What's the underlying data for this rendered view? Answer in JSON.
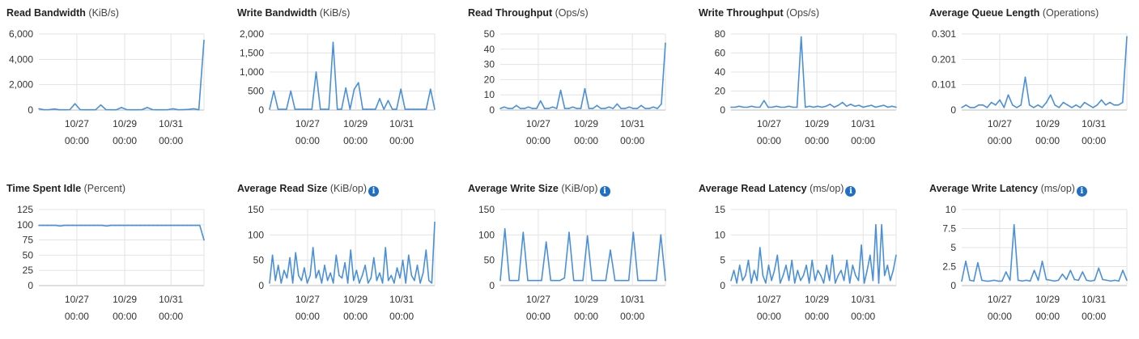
{
  "dashboard": {
    "panels": [
      {
        "title": "Read Bandwidth",
        "unit": "(KiB/s)",
        "info": false
      },
      {
        "title": "Write Bandwidth",
        "unit": "(KiB/s)",
        "info": false
      },
      {
        "title": "Read Throughput",
        "unit": "(Ops/s)",
        "info": false
      },
      {
        "title": "Write Throughput",
        "unit": "(Ops/s)",
        "info": false
      },
      {
        "title": "Average Queue Length",
        "unit": "(Operations)",
        "info": false
      },
      {
        "title": "Time Spent Idle",
        "unit": "(Percent)",
        "info": false
      },
      {
        "title": "Average Read Size",
        "unit": "(KiB/op)",
        "info": true
      },
      {
        "title": "Average Write Size",
        "unit": "(KiB/op)",
        "info": true
      },
      {
        "title": "Average Read Latency",
        "unit": "(ms/op)",
        "info": true
      },
      {
        "title": "Average Write Latency",
        "unit": "(ms/op)",
        "info": true
      }
    ]
  },
  "colors": {
    "line": "#4a90d9",
    "grid": "#e3e3e3",
    "baseline": "#bdbdbd"
  },
  "chart_data": [
    {
      "type": "line",
      "title": "Read Bandwidth",
      "ylabel": "KiB/s",
      "ylim": [
        0,
        6000
      ],
      "yticks": [
        "0",
        "2,000",
        "4,000",
        "6,000"
      ],
      "xticks": [
        "10/27",
        "10/29",
        "10/31"
      ],
      "xticks_sub": [
        "00:00",
        "00:00",
        "00:00"
      ],
      "series": [
        {
          "values": [
            100,
            20,
            30,
            80,
            20,
            20,
            30,
            500,
            30,
            20,
            20,
            20,
            400,
            30,
            20,
            20,
            200,
            30,
            20,
            20,
            30,
            200,
            30,
            20,
            20,
            30,
            100,
            20,
            30,
            50,
            100,
            20,
            5500
          ]
        }
      ]
    },
    {
      "type": "line",
      "title": "Write Bandwidth",
      "ylabel": "KiB/s",
      "ylim": [
        0,
        2000
      ],
      "yticks": [
        "0",
        "500",
        "1,000",
        "1,500",
        "2,000"
      ],
      "xticks": [
        "10/27",
        "10/29",
        "10/31"
      ],
      "xticks_sub": [
        "00:00",
        "00:00",
        "00:00"
      ],
      "series": [
        {
          "values": [
            20,
            500,
            20,
            20,
            20,
            500,
            20,
            20,
            20,
            20,
            20,
            1000,
            20,
            20,
            20,
            1780,
            20,
            20,
            580,
            20,
            550,
            720,
            20,
            20,
            20,
            20,
            300,
            20,
            250,
            20,
            20,
            550,
            20,
            20,
            20,
            20,
            20,
            20,
            550,
            20
          ]
        }
      ]
    },
    {
      "type": "line",
      "title": "Read Throughput",
      "ylabel": "Ops/s",
      "ylim": [
        0,
        50
      ],
      "yticks": [
        "0",
        "10",
        "20",
        "30",
        "40",
        "50"
      ],
      "xticks": [
        "10/27",
        "10/29",
        "10/31"
      ],
      "xticks_sub": [
        "00:00",
        "00:00",
        "00:00"
      ],
      "series": [
        {
          "values": [
            1,
            2,
            1,
            1,
            3,
            1,
            1,
            2,
            1,
            1,
            6,
            1,
            1,
            2,
            1,
            13,
            1,
            1,
            2,
            1,
            1,
            14,
            1,
            1,
            3,
            1,
            1,
            2,
            1,
            4,
            1,
            1,
            2,
            1,
            1,
            3,
            1,
            1,
            2,
            1,
            4,
            44
          ]
        }
      ]
    },
    {
      "type": "line",
      "title": "Write Throughput",
      "ylabel": "Ops/s",
      "ylim": [
        0,
        80
      ],
      "yticks": [
        "0",
        "20",
        "40",
        "60",
        "80"
      ],
      "xticks": [
        "10/27",
        "10/29",
        "10/31"
      ],
      "xticks_sub": [
        "00:00",
        "00:00",
        "00:00"
      ],
      "series": [
        {
          "values": [
            3,
            3,
            4,
            3,
            3,
            4,
            3,
            3,
            10,
            3,
            3,
            4,
            3,
            3,
            4,
            3,
            3,
            77,
            3,
            4,
            3,
            4,
            3,
            4,
            6,
            3,
            5,
            8,
            4,
            6,
            4,
            5,
            3,
            4,
            5,
            3,
            4,
            5,
            3,
            4,
            3
          ]
        }
      ]
    },
    {
      "type": "line",
      "title": "Average Queue Length",
      "ylabel": "Operations",
      "ylim": [
        0,
        0.301
      ],
      "yticks": [
        "0",
        "0.101",
        "0.201",
        "0.301"
      ],
      "xticks": [
        "10/27",
        "10/29",
        "10/31"
      ],
      "xticks_sub": [
        "00:00",
        "00:00",
        "00:00"
      ],
      "series": [
        {
          "values": [
            0.01,
            0.02,
            0.01,
            0.01,
            0.02,
            0.02,
            0.01,
            0.03,
            0.02,
            0.04,
            0.01,
            0.06,
            0.02,
            0.01,
            0.02,
            0.13,
            0.02,
            0.01,
            0.02,
            0.01,
            0.03,
            0.06,
            0.02,
            0.01,
            0.03,
            0.02,
            0.01,
            0.02,
            0.01,
            0.03,
            0.02,
            0.01,
            0.02,
            0.04,
            0.02,
            0.03,
            0.02,
            0.02,
            0.03,
            0.29
          ]
        }
      ]
    },
    {
      "type": "line",
      "title": "Time Spent Idle",
      "ylabel": "Percent",
      "ylim": [
        0,
        125
      ],
      "yticks": [
        "0",
        "25",
        "50",
        "75",
        "100",
        "125"
      ],
      "xticks": [
        "10/27",
        "10/29",
        "10/31"
      ],
      "xticks_sub": [
        "00:00",
        "00:00",
        "00:00"
      ],
      "series": [
        {
          "values": [
            99,
            99,
            99,
            99,
            99,
            98,
            99,
            99,
            99,
            99,
            99,
            99,
            99,
            99,
            99,
            99,
            98,
            99,
            99,
            99,
            99,
            99,
            99,
            99,
            99,
            99,
            99,
            99,
            99,
            99,
            99,
            99,
            99,
            99,
            99,
            99,
            99,
            99,
            99,
            75
          ]
        }
      ]
    },
    {
      "type": "line",
      "title": "Average Read Size",
      "ylabel": "KiB/op",
      "ylim": [
        0,
        150
      ],
      "yticks": [
        "0",
        "50",
        "100",
        "150"
      ],
      "xticks": [
        "10/27",
        "10/29",
        "10/31"
      ],
      "xticks_sub": [
        "00:00",
        "00:00",
        "00:00"
      ],
      "series": [
        {
          "values": [
            5,
            60,
            10,
            40,
            5,
            30,
            15,
            55,
            5,
            65,
            20,
            10,
            35,
            5,
            20,
            75,
            15,
            30,
            5,
            40,
            10,
            25,
            5,
            60,
            20,
            15,
            45,
            5,
            70,
            10,
            30,
            5,
            20,
            40,
            5,
            15,
            55,
            10,
            25,
            5,
            75,
            10,
            20,
            5,
            35,
            15,
            50,
            5,
            60,
            20,
            10,
            40,
            5,
            25,
            70,
            10,
            5,
            125
          ]
        }
      ]
    },
    {
      "type": "line",
      "title": "Average Write Size",
      "ylabel": "KiB/op",
      "ylim": [
        0,
        150
      ],
      "yticks": [
        "0",
        "50",
        "100",
        "150"
      ],
      "xticks": [
        "10/27",
        "10/29",
        "10/31"
      ],
      "xticks_sub": [
        "00:00",
        "00:00",
        "00:00"
      ],
      "series": [
        {
          "values": [
            10,
            112,
            10,
            10,
            10,
            105,
            10,
            10,
            10,
            10,
            86,
            10,
            10,
            10,
            15,
            105,
            10,
            10,
            10,
            98,
            10,
            10,
            10,
            10,
            70,
            10,
            10,
            10,
            10,
            105,
            10,
            10,
            10,
            10,
            10,
            100,
            10
          ]
        }
      ]
    },
    {
      "type": "line",
      "title": "Average Read Latency",
      "ylabel": "ms/op",
      "ylim": [
        0,
        15
      ],
      "yticks": [
        "0",
        "5",
        "10",
        "15"
      ],
      "xticks": [
        "10/27",
        "10/29",
        "10/31"
      ],
      "xticks_sub": [
        "00:00",
        "00:00",
        "00:00"
      ],
      "series": [
        {
          "values": [
            1,
            3,
            0.5,
            4,
            1,
            2,
            5,
            0.5,
            3,
            1,
            7.5,
            2,
            0.5,
            4,
            1,
            3,
            6,
            0.5,
            2,
            4,
            1,
            5,
            0.5,
            3,
            1,
            2,
            4,
            0.5,
            5,
            1,
            3,
            2,
            0.5,
            4,
            1,
            6,
            0.5,
            2,
            3,
            1,
            5,
            0.5,
            4,
            2,
            1,
            8,
            0.5,
            3,
            6,
            1,
            12,
            0.5,
            12,
            2,
            4,
            1,
            3,
            6
          ]
        }
      ]
    },
    {
      "type": "line",
      "title": "Average Write Latency",
      "ylabel": "ms/op",
      "ylim": [
        0,
        10
      ],
      "yticks": [
        "0",
        "2.5",
        "5",
        "7.5",
        "10"
      ],
      "xticks": [
        "10/27",
        "10/29",
        "10/31"
      ],
      "xticks_sub": [
        "00:00",
        "00:00",
        "00:00"
      ],
      "series": [
        {
          "values": [
            0.6,
            3.2,
            0.7,
            0.6,
            3.0,
            0.7,
            0.6,
            0.6,
            0.7,
            0.6,
            0.6,
            1.8,
            0.7,
            8.0,
            0.7,
            0.6,
            0.7,
            0.6,
            2.0,
            0.7,
            3.2,
            0.8,
            0.7,
            0.6,
            0.7,
            1.5,
            0.8,
            2.0,
            0.8,
            0.7,
            1.8,
            0.7,
            0.6,
            0.7,
            2.3,
            0.8,
            0.7,
            0.6,
            0.7,
            0.6,
            2.0,
            0.7
          ]
        }
      ]
    }
  ]
}
